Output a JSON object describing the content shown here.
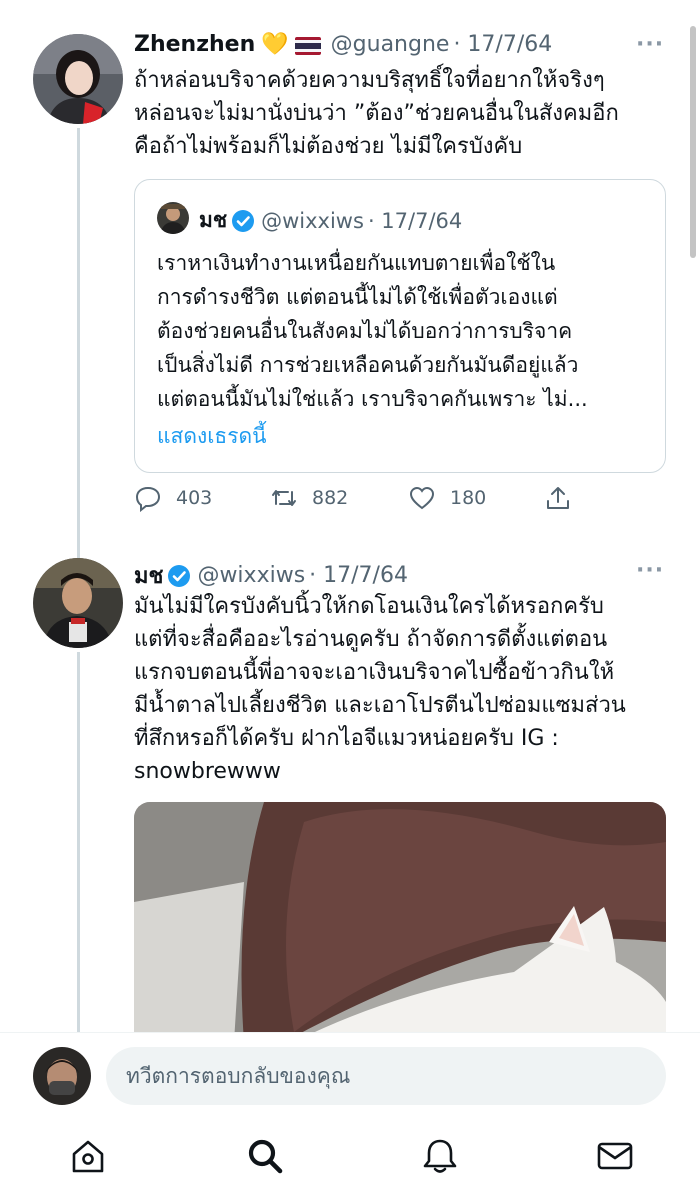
{
  "colors": {
    "accent": "#1d9bf0",
    "muted": "#536471",
    "line": "#cfd9de",
    "verified": "#1d9bf0"
  },
  "tweet1": {
    "name": "Zhenzhen",
    "emoji": "💛",
    "flag_icon": "thailand-flag",
    "handle": "@guangne",
    "date": "· 17/7/64",
    "more": "···",
    "text": "ถ้าหล่อนบริจาคด้วยความบริสุทธิ์ใจที่อยากให้จริงๆ\nหล่อนจะไม่มานั่งบ่นว่า ”ต้อง”ช่วยคนอื่นในสังคมอีก\nคือถ้าไม่พร้อมก็ไม่ต้องช่วย ไม่มีใครบังคับ",
    "quote": {
      "name": "มช",
      "handle": "@wixxiws",
      "date": "· 17/7/64",
      "text": "เราหาเงินทำงานเหนื่อยกันแทบตายเพื่อใช้ใน\nการดำรงชีวิต แต่ตอนนี้ไม่ได้ใช้เพื่อตัวเองแต่\nต้องช่วยคนอื่นในสังคมไม่ได้บอกว่าการบริจาค\nเป็นสิ่งไม่ดี การช่วยเหลือคนด้วยกันมันดีอยู่แล้ว\nแต่ตอนนี้มันไม่ใช่แล้ว เราบริจาคกันเพราะ ไม่...",
      "show_thread": "แสดงเธรดนี้"
    },
    "actions": {
      "replies": "403",
      "retweets": "882",
      "likes": "180"
    }
  },
  "tweet2": {
    "name": "มช",
    "handle": "@wixxiws",
    "date": "· 17/7/64",
    "more": "···",
    "text": "มันไม่มีใครบังคับนิ้วให้กดโอนเงินใครได้หรอกครับ\nแต่ที่จะสื่อคืออะไรอ่านดูครับ ถ้าจัดการดีตั้งแต่ตอน\nแรกจบตอนนี้พี่อาจจะเอาเงินบริจาคไปซื้อข้าวกินให้\nมีน้ำตาลไปเลี้ยงชีวิต และเอาโปรตีนไปซ่อมแซมส่วน\nที่สึกหรอก็ได้ครับ     ฝากไอจีแมวหน่อยครับ IG :\nsnowbrewww"
  },
  "reply_bar": {
    "placeholder": "ทวีตการตอบกลับของคุณ"
  },
  "tabs": [
    "home-icon",
    "search-icon",
    "notifications-icon",
    "messages-icon"
  ]
}
